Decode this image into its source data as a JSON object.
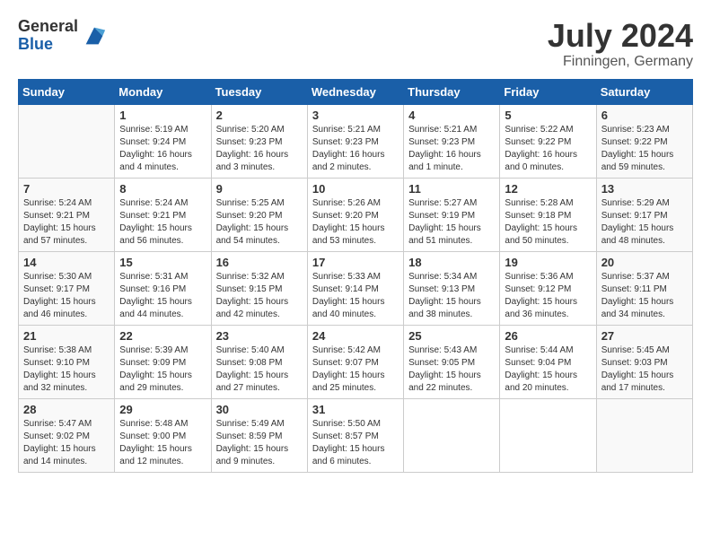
{
  "header": {
    "logo_general": "General",
    "logo_blue": "Blue",
    "month_title": "July 2024",
    "location": "Finningen, Germany"
  },
  "weekdays": [
    "Sunday",
    "Monday",
    "Tuesday",
    "Wednesday",
    "Thursday",
    "Friday",
    "Saturday"
  ],
  "weeks": [
    [
      {
        "day": "",
        "sunrise": "",
        "sunset": "",
        "daylight": ""
      },
      {
        "day": "1",
        "sunrise": "Sunrise: 5:19 AM",
        "sunset": "Sunset: 9:24 PM",
        "daylight": "Daylight: 16 hours and 4 minutes."
      },
      {
        "day": "2",
        "sunrise": "Sunrise: 5:20 AM",
        "sunset": "Sunset: 9:23 PM",
        "daylight": "Daylight: 16 hours and 3 minutes."
      },
      {
        "day": "3",
        "sunrise": "Sunrise: 5:21 AM",
        "sunset": "Sunset: 9:23 PM",
        "daylight": "Daylight: 16 hours and 2 minutes."
      },
      {
        "day": "4",
        "sunrise": "Sunrise: 5:21 AM",
        "sunset": "Sunset: 9:23 PM",
        "daylight": "Daylight: 16 hours and 1 minute."
      },
      {
        "day": "5",
        "sunrise": "Sunrise: 5:22 AM",
        "sunset": "Sunset: 9:22 PM",
        "daylight": "Daylight: 16 hours and 0 minutes."
      },
      {
        "day": "6",
        "sunrise": "Sunrise: 5:23 AM",
        "sunset": "Sunset: 9:22 PM",
        "daylight": "Daylight: 15 hours and 59 minutes."
      }
    ],
    [
      {
        "day": "7",
        "sunrise": "Sunrise: 5:24 AM",
        "sunset": "Sunset: 9:21 PM",
        "daylight": "Daylight: 15 hours and 57 minutes."
      },
      {
        "day": "8",
        "sunrise": "Sunrise: 5:24 AM",
        "sunset": "Sunset: 9:21 PM",
        "daylight": "Daylight: 15 hours and 56 minutes."
      },
      {
        "day": "9",
        "sunrise": "Sunrise: 5:25 AM",
        "sunset": "Sunset: 9:20 PM",
        "daylight": "Daylight: 15 hours and 54 minutes."
      },
      {
        "day": "10",
        "sunrise": "Sunrise: 5:26 AM",
        "sunset": "Sunset: 9:20 PM",
        "daylight": "Daylight: 15 hours and 53 minutes."
      },
      {
        "day": "11",
        "sunrise": "Sunrise: 5:27 AM",
        "sunset": "Sunset: 9:19 PM",
        "daylight": "Daylight: 15 hours and 51 minutes."
      },
      {
        "day": "12",
        "sunrise": "Sunrise: 5:28 AM",
        "sunset": "Sunset: 9:18 PM",
        "daylight": "Daylight: 15 hours and 50 minutes."
      },
      {
        "day": "13",
        "sunrise": "Sunrise: 5:29 AM",
        "sunset": "Sunset: 9:17 PM",
        "daylight": "Daylight: 15 hours and 48 minutes."
      }
    ],
    [
      {
        "day": "14",
        "sunrise": "Sunrise: 5:30 AM",
        "sunset": "Sunset: 9:17 PM",
        "daylight": "Daylight: 15 hours and 46 minutes."
      },
      {
        "day": "15",
        "sunrise": "Sunrise: 5:31 AM",
        "sunset": "Sunset: 9:16 PM",
        "daylight": "Daylight: 15 hours and 44 minutes."
      },
      {
        "day": "16",
        "sunrise": "Sunrise: 5:32 AM",
        "sunset": "Sunset: 9:15 PM",
        "daylight": "Daylight: 15 hours and 42 minutes."
      },
      {
        "day": "17",
        "sunrise": "Sunrise: 5:33 AM",
        "sunset": "Sunset: 9:14 PM",
        "daylight": "Daylight: 15 hours and 40 minutes."
      },
      {
        "day": "18",
        "sunrise": "Sunrise: 5:34 AM",
        "sunset": "Sunset: 9:13 PM",
        "daylight": "Daylight: 15 hours and 38 minutes."
      },
      {
        "day": "19",
        "sunrise": "Sunrise: 5:36 AM",
        "sunset": "Sunset: 9:12 PM",
        "daylight": "Daylight: 15 hours and 36 minutes."
      },
      {
        "day": "20",
        "sunrise": "Sunrise: 5:37 AM",
        "sunset": "Sunset: 9:11 PM",
        "daylight": "Daylight: 15 hours and 34 minutes."
      }
    ],
    [
      {
        "day": "21",
        "sunrise": "Sunrise: 5:38 AM",
        "sunset": "Sunset: 9:10 PM",
        "daylight": "Daylight: 15 hours and 32 minutes."
      },
      {
        "day": "22",
        "sunrise": "Sunrise: 5:39 AM",
        "sunset": "Sunset: 9:09 PM",
        "daylight": "Daylight: 15 hours and 29 minutes."
      },
      {
        "day": "23",
        "sunrise": "Sunrise: 5:40 AM",
        "sunset": "Sunset: 9:08 PM",
        "daylight": "Daylight: 15 hours and 27 minutes."
      },
      {
        "day": "24",
        "sunrise": "Sunrise: 5:42 AM",
        "sunset": "Sunset: 9:07 PM",
        "daylight": "Daylight: 15 hours and 25 minutes."
      },
      {
        "day": "25",
        "sunrise": "Sunrise: 5:43 AM",
        "sunset": "Sunset: 9:05 PM",
        "daylight": "Daylight: 15 hours and 22 minutes."
      },
      {
        "day": "26",
        "sunrise": "Sunrise: 5:44 AM",
        "sunset": "Sunset: 9:04 PM",
        "daylight": "Daylight: 15 hours and 20 minutes."
      },
      {
        "day": "27",
        "sunrise": "Sunrise: 5:45 AM",
        "sunset": "Sunset: 9:03 PM",
        "daylight": "Daylight: 15 hours and 17 minutes."
      }
    ],
    [
      {
        "day": "28",
        "sunrise": "Sunrise: 5:47 AM",
        "sunset": "Sunset: 9:02 PM",
        "daylight": "Daylight: 15 hours and 14 minutes."
      },
      {
        "day": "29",
        "sunrise": "Sunrise: 5:48 AM",
        "sunset": "Sunset: 9:00 PM",
        "daylight": "Daylight: 15 hours and 12 minutes."
      },
      {
        "day": "30",
        "sunrise": "Sunrise: 5:49 AM",
        "sunset": "Sunset: 8:59 PM",
        "daylight": "Daylight: 15 hours and 9 minutes."
      },
      {
        "day": "31",
        "sunrise": "Sunrise: 5:50 AM",
        "sunset": "Sunset: 8:57 PM",
        "daylight": "Daylight: 15 hours and 6 minutes."
      },
      {
        "day": "",
        "sunrise": "",
        "sunset": "",
        "daylight": ""
      },
      {
        "day": "",
        "sunrise": "",
        "sunset": "",
        "daylight": ""
      },
      {
        "day": "",
        "sunrise": "",
        "sunset": "",
        "daylight": ""
      }
    ]
  ]
}
